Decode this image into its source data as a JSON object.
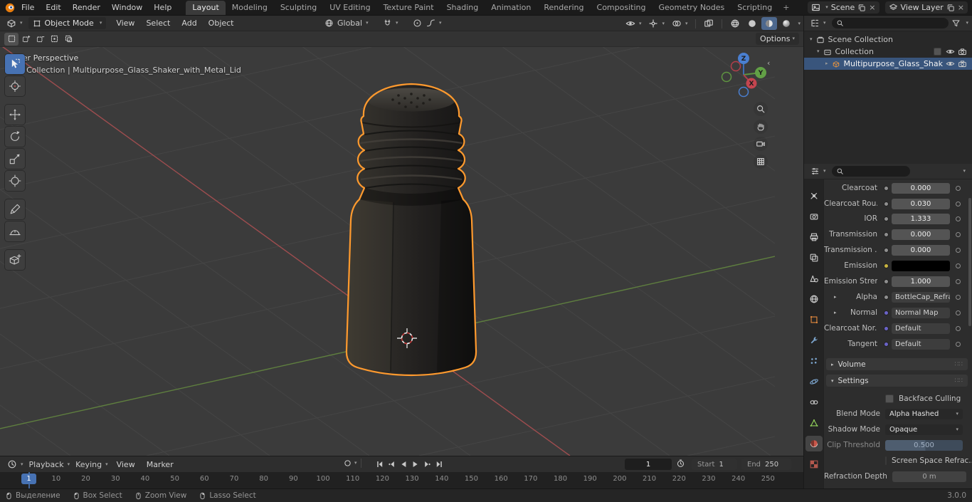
{
  "topbar": {
    "menus": [
      "File",
      "Edit",
      "Render",
      "Window",
      "Help"
    ],
    "workspaces": [
      "Layout",
      "Modeling",
      "Sculpting",
      "UV Editing",
      "Texture Paint",
      "Shading",
      "Animation",
      "Rendering",
      "Compositing",
      "Geometry Nodes",
      "Scripting"
    ],
    "active_workspace": "Layout",
    "add_tab": "+",
    "scene_value": "Scene",
    "view_layer_value": "View Layer"
  },
  "viewport_header": {
    "mode": "Object Mode",
    "menus": [
      "View",
      "Select",
      "Add",
      "Object"
    ],
    "orientation": "Global",
    "options": "Options"
  },
  "viewport": {
    "view_label": "User Perspective",
    "context_label": "(1) Collection | Multipurpose_Glass_Shaker_with_Metal_Lid",
    "gizmo": {
      "x": "X",
      "y": "Y",
      "z": "Z"
    }
  },
  "outliner": {
    "rows": [
      {
        "label": "Scene Collection"
      },
      {
        "label": "Collection"
      },
      {
        "label": "Multipurpose_Glass_Shak"
      }
    ]
  },
  "properties": {
    "tabs": [
      "tool",
      "render",
      "output",
      "view-layer",
      "scene",
      "world",
      "object",
      "modifiers",
      "particles",
      "physics",
      "constraints",
      "object-data",
      "material",
      "texture"
    ],
    "active_tab": "material",
    "rows": [
      {
        "label": "Clearcoat",
        "value": "0.000"
      },
      {
        "label": "Clearcoat Rou...",
        "value": "0.030"
      },
      {
        "label": "IOR",
        "value": "1.333"
      },
      {
        "label": "Transmission",
        "value": "0.000"
      },
      {
        "label": "Transmission ...",
        "value": "0.000"
      },
      {
        "label": "Emission",
        "value": ""
      },
      {
        "label": "Emission Stren...",
        "value": "1.000"
      },
      {
        "label": "Alpha",
        "value": "BottleCap_Refrac..."
      },
      {
        "label": "Normal",
        "value": "Normal Map"
      },
      {
        "label": "Clearcoat Nor...",
        "value": "Default"
      },
      {
        "label": "Tangent",
        "value": "Default"
      }
    ],
    "volume_section": "Volume",
    "settings_section": "Settings",
    "settings": {
      "backface_culling": "Backface Culling",
      "blend_mode_label": "Blend Mode",
      "blend_mode": "Alpha Hashed",
      "shadow_mode_label": "Shadow Mode",
      "shadow_mode": "Opaque",
      "clip_threshold_label": "Clip Threshold",
      "clip_threshold": "0.500",
      "screen_space": "Screen Space Refrac...",
      "refraction_label": "Refraction Depth",
      "refraction": "0 m"
    }
  },
  "timeline": {
    "menus": [
      "Playback",
      "Keying",
      "View",
      "Marker"
    ],
    "current_frame": "1",
    "start_label": "Start",
    "start_value": "1",
    "end_label": "End",
    "end_value": "250",
    "ticks": [
      "10",
      "20",
      "30",
      "40",
      "50",
      "60",
      "70",
      "80",
      "90",
      "100",
      "110",
      "120",
      "130",
      "140",
      "150",
      "160",
      "170",
      "180",
      "190",
      "200",
      "210",
      "220",
      "230",
      "240",
      "250"
    ]
  },
  "statusbar": {
    "select_hint": "Выделение",
    "box_select": "Box Select",
    "zoom_view": "Zoom View",
    "lasso_select": "Lasso Select",
    "version": "3.0.0"
  },
  "colors": {
    "accent": "#4772b3",
    "selection_outline": "#ff9a2e",
    "axis_x": "#9e4d4f",
    "axis_y": "#5f7f3f",
    "viewport_bg": "#3b3b3b"
  },
  "icons": [
    "blender-logo",
    "search-icon",
    "filter-icon",
    "eye-icon",
    "camera-icon",
    "magnet-icon",
    "proportional-icon",
    "falloff-icon",
    "globe-icon",
    "clock-icon",
    "record-icon",
    "mouse-left-icon",
    "mouse-middle-icon",
    "mouse-right-icon",
    "navigation-gizmo",
    "zoom-icon",
    "hand-icon",
    "camera-view-icon",
    "ortho-grid-icon"
  ]
}
